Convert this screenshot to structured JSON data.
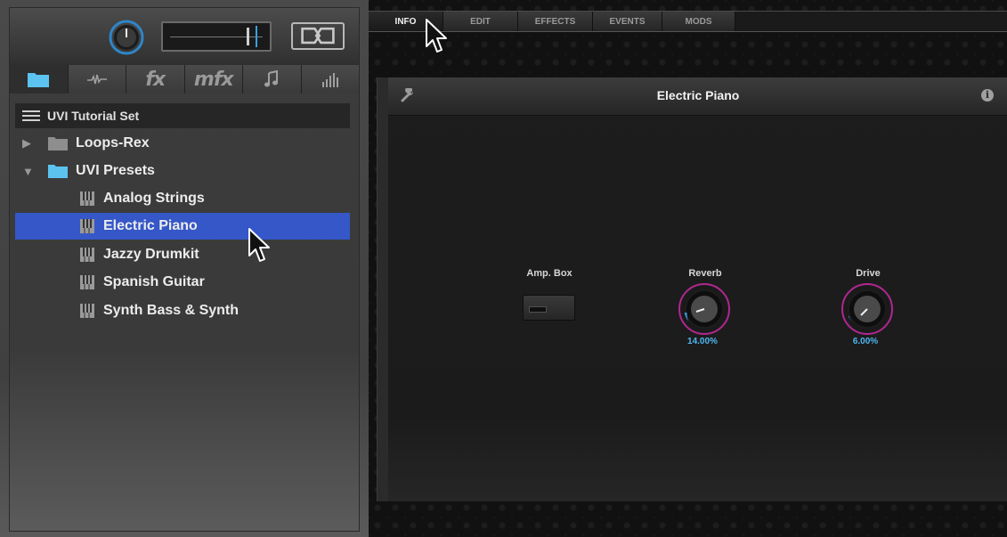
{
  "left_panel": {
    "tabs": [
      {
        "name": "browser",
        "icon": "folder-icon",
        "label": ""
      },
      {
        "name": "waveform",
        "icon": "waveform-icon",
        "label": ""
      },
      {
        "name": "fx",
        "icon": "fx-icon",
        "label": "fx"
      },
      {
        "name": "mfx",
        "icon": "mfx-icon",
        "label": "mfx"
      },
      {
        "name": "music",
        "icon": "music-note-icon",
        "label": ""
      },
      {
        "name": "mixer",
        "icon": "mixer-bars-icon",
        "label": ""
      }
    ],
    "browser": {
      "title": "UVI Tutorial Set",
      "folders": [
        {
          "label": "Loops-Rex",
          "expanded": false
        },
        {
          "label": "UVI Presets",
          "expanded": true
        }
      ],
      "presets": [
        "Analog Strings",
        "Electric Piano",
        "Jazzy Drumkit",
        "Spanish Guitar",
        "Synth Bass & Synth"
      ],
      "selected": "Electric Piano"
    }
  },
  "right_panel": {
    "tabs": [
      "INFO",
      "EDIT",
      "EFFECTS",
      "EVENTS",
      "MODS"
    ],
    "active_tab": "INFO",
    "preset": {
      "title": "Electric Piano",
      "controls": {
        "ampbox_label": "Amp. Box",
        "reverb_label": "Reverb",
        "reverb_value": "14.00%",
        "drive_label": "Drive",
        "drive_value": "6.00%"
      }
    }
  },
  "colors": {
    "accent_blue": "#3aa0e0",
    "selection": "#3557c8",
    "knob_ring": "#b0278f"
  }
}
